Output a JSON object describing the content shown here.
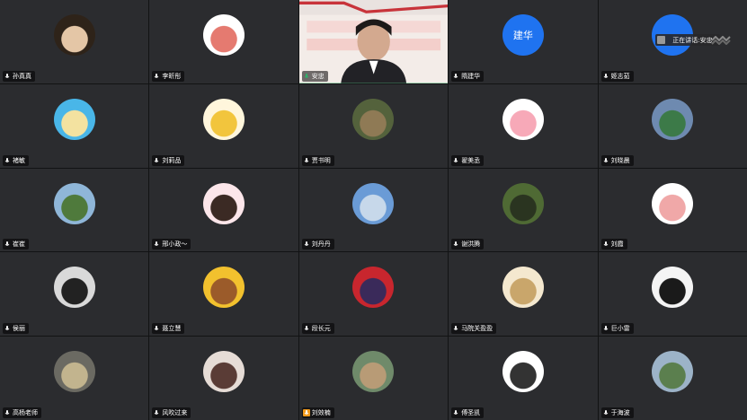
{
  "speaker": {
    "prefix": "正在讲话:",
    "name": "安忠;"
  },
  "participants": [
    {
      "name": "孙真真",
      "avatar": "photo",
      "bg": "#2e2319",
      "fg": "#e4c6a6"
    },
    {
      "name": "李昕彤",
      "avatar": "photo",
      "bg": "#ffffff",
      "fg": "#e57a70"
    },
    {
      "name": "安忠",
      "avatar": "video",
      "mic": "green"
    },
    {
      "name": "隋建华",
      "avatar": "text",
      "text": "建华"
    },
    {
      "name": "姬志茹",
      "avatar": "photo",
      "bg": "#1f73f0",
      "fg": "#1f73f0"
    },
    {
      "name": "褚敏",
      "avatar": "photo",
      "bg": "#49b6e8",
      "fg": "#f3e2a0"
    },
    {
      "name": "刘莉品",
      "avatar": "photo",
      "bg": "#fff6dc",
      "fg": "#f2c53d"
    },
    {
      "name": "贾书明",
      "avatar": "photo",
      "bg": "#54623c",
      "fg": "#8f7a55"
    },
    {
      "name": "翟美丞",
      "avatar": "photo",
      "bg": "#ffffff",
      "fg": "#f7a9b8"
    },
    {
      "name": "刘晓晨",
      "avatar": "photo",
      "bg": "#6e8ab0",
      "fg": "#3c7a48"
    },
    {
      "name": "崔崔",
      "avatar": "photo",
      "bg": "#8fb6d8",
      "fg": "#4f7a3c"
    },
    {
      "name": "邢小政～",
      "avatar": "photo",
      "bg": "#fce6ea",
      "fg": "#3b2a24"
    },
    {
      "name": "刘丹丹",
      "avatar": "photo",
      "bg": "#6a9bd6",
      "fg": "#c7d8ea"
    },
    {
      "name": "谢洪腾",
      "avatar": "photo",
      "bg": "#4f6a34",
      "fg": "#2a3420"
    },
    {
      "name": "刘霞",
      "avatar": "photo",
      "bg": "#ffffff",
      "fg": "#f0a8a8"
    },
    {
      "name": "侯丽",
      "avatar": "photo",
      "bg": "#d9d9d9",
      "fg": "#222222"
    },
    {
      "name": "聂立慧",
      "avatar": "photo",
      "bg": "#f2c12e",
      "fg": "#9b5b2a"
    },
    {
      "name": "段长元",
      "avatar": "photo",
      "bg": "#c8262e",
      "fg": "#3a2a5a"
    },
    {
      "name": "马院关盈盈",
      "avatar": "photo",
      "bg": "#f4e8cf",
      "fg": "#c9a66b"
    },
    {
      "name": "巨小雷",
      "avatar": "photo",
      "bg": "#f4f4f4",
      "fg": "#1a1a1a"
    },
    {
      "name": "高杨老师",
      "avatar": "photo",
      "bg": "#6b6a62",
      "fg": "#c2b48e"
    },
    {
      "name": "风吹过来",
      "avatar": "photo",
      "bg": "#e6dcd6",
      "fg": "#5a3c36"
    },
    {
      "name": "刘效楠",
      "avatar": "photo",
      "bg": "#6f8a6a",
      "fg": "#b89b76",
      "mic": "orange"
    },
    {
      "name": "傅圣凯",
      "avatar": "photo",
      "bg": "#ffffff",
      "fg": "#333333"
    },
    {
      "name": "于海波",
      "avatar": "photo",
      "bg": "#9cb3c8",
      "fg": "#5b7f4e"
    }
  ],
  "icons": {
    "mic": "mic-icon",
    "speaker": "speaker-icon",
    "more": "more-icon"
  },
  "colors": {
    "tile_bg": "#2b2c2f",
    "grid_bg": "#121314",
    "active_border": "#2fb36a",
    "text_avatar": "#1f73f0"
  }
}
